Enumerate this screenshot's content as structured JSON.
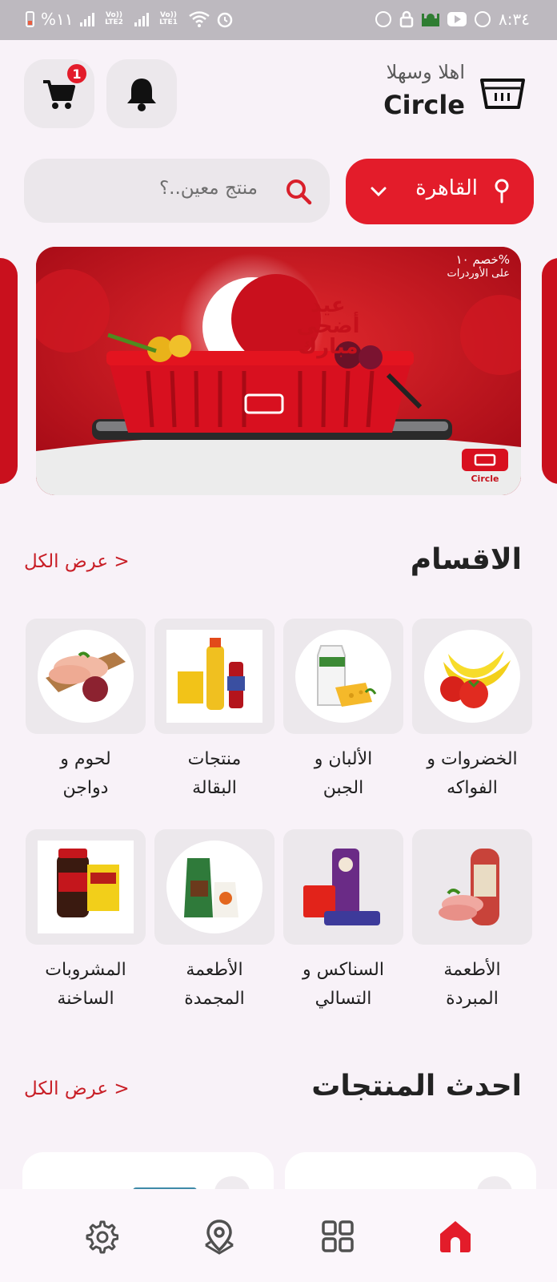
{
  "status_bar": {
    "battery": "%١١",
    "sim1": "Vo)) LTE2",
    "sim2": "Vo)) LTE1",
    "time": "٨:٣٤"
  },
  "header": {
    "greeting": "اهلا وسهلا",
    "brand": "Circle",
    "cart_count": "1",
    "icons": [
      "basket-logo-icon",
      "bell-icon",
      "cart-icon"
    ]
  },
  "search": {
    "placeholder": "منتج معين..؟"
  },
  "location": {
    "city": "القاهرة"
  },
  "banner": {
    "offer_line1": "خصم ١٠%",
    "offer_line2": "على الأوردرات",
    "greeting_lines": [
      "عيد",
      "أضحى",
      "مبارك"
    ],
    "logo_text": "Circle"
  },
  "categories_section": {
    "title": "الاقسام",
    "see_all": "عرض الكل >",
    "items": [
      {
        "line1": "الخضروات و",
        "line2": "الفواكه"
      },
      {
        "line1": "الألبان و",
        "line2": "الجبن"
      },
      {
        "line1": "منتجات",
        "line2": "البقالة"
      },
      {
        "line1": "لحوم و",
        "line2": "دواجن"
      },
      {
        "line1": "الأطعمة",
        "line2": "المبردة"
      },
      {
        "line1": "السناكس و",
        "line2": "التسالي"
      },
      {
        "line1": "الأطعمة",
        "line2": "المجمدة"
      },
      {
        "line1": "المشروبات",
        "line2": "الساخنة"
      }
    ]
  },
  "products_section": {
    "title": "احدث المنتجات",
    "see_all": "عرض الكل >"
  },
  "bottom_nav": {
    "items": [
      "home-icon",
      "grid-icon",
      "map-pin-icon",
      "settings-icon"
    ],
    "active": "home-icon",
    "active_color": "#e31c2a"
  },
  "colors": {
    "accent": "#e31c2a",
    "background": "#f8f2f8",
    "tile": "#ece8ec"
  }
}
